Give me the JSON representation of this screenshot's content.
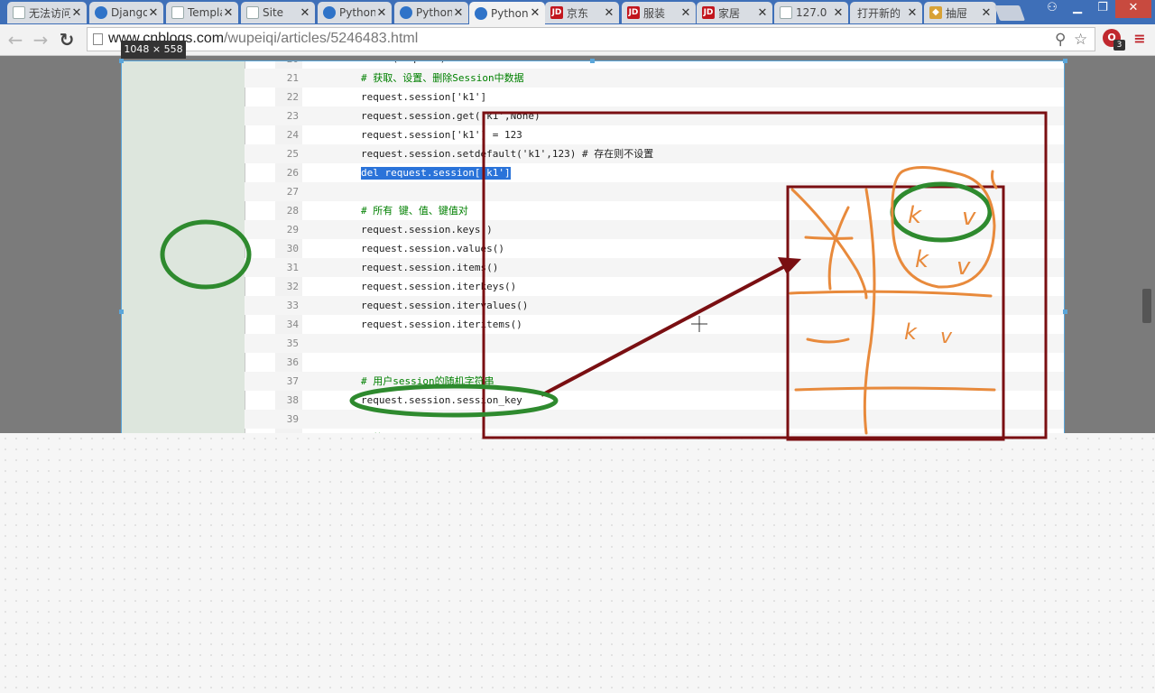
{
  "tabs": [
    {
      "title": "无法访问",
      "icon": "doc"
    },
    {
      "title": "Django",
      "icon": "globe"
    },
    {
      "title": "Template",
      "icon": "doc"
    },
    {
      "title": "Site",
      "icon": "doc"
    },
    {
      "title": "Python",
      "icon": "globe"
    },
    {
      "title": "Python",
      "icon": "globe"
    },
    {
      "title": "Python",
      "icon": "globe",
      "active": true
    },
    {
      "title": "京东",
      "icon": "jd"
    },
    {
      "title": "服装",
      "icon": "jd"
    },
    {
      "title": "家居",
      "icon": "jd"
    },
    {
      "title": "127.0",
      "icon": "doc"
    },
    {
      "title": "打开新的",
      "icon": "none"
    },
    {
      "title": "抽屉",
      "icon": "game"
    }
  ],
  "toolbar": {
    "url_host": "www.cnblogs.com",
    "url_path": "/wupeiqi/articles/5246483.html",
    "extension_badge": "3"
  },
  "screenshot_tool": {
    "size_label": "1048 × 558"
  },
  "code": {
    "partial_top": "def index(request):",
    "lines": [
      {
        "no": "21",
        "text": "# 获取、设置、删除Session中数据"
      },
      {
        "no": "22",
        "text": "request.session['k1']"
      },
      {
        "no": "23",
        "text": "request.session.get('k1',None)"
      },
      {
        "no": "24",
        "text": "request.session['k1'] = 123"
      },
      {
        "no": "25",
        "text": "request.session.setdefault('k1',123) # 存在则不设置"
      },
      {
        "no": "26",
        "text": "del request.session['k1']"
      },
      {
        "no": "27",
        "text": ""
      },
      {
        "no": "28",
        "text": "# 所有 键、值、键值对"
      },
      {
        "no": "29",
        "text": "request.session.keys()"
      },
      {
        "no": "30",
        "text": "request.session.values()"
      },
      {
        "no": "31",
        "text": "request.session.items()"
      },
      {
        "no": "32",
        "text": "request.session.iterkeys()"
      },
      {
        "no": "33",
        "text": "request.session.itervalues()"
      },
      {
        "no": "34",
        "text": "request.session.iteritems()"
      },
      {
        "no": "35",
        "text": ""
      },
      {
        "no": "36",
        "text": ""
      },
      {
        "no": "37",
        "text": "# 用户session的随机字符串"
      },
      {
        "no": "38",
        "text": "request.session.session_key"
      },
      {
        "no": "39",
        "text": ""
      },
      {
        "no": "40",
        "text": "# 将..."
      }
    ]
  },
  "annotations": {
    "handwriting": [
      "k",
      "v",
      "k",
      "v",
      "k",
      "v"
    ]
  }
}
